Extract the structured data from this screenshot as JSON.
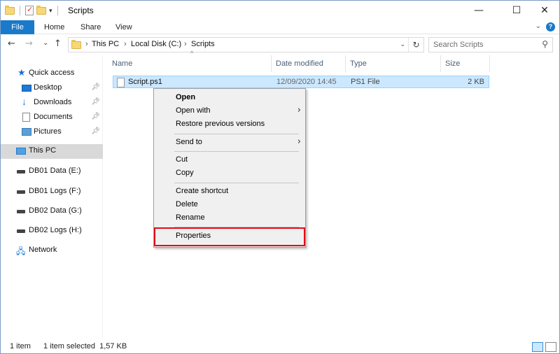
{
  "window": {
    "title": "Scripts",
    "minimize": "—",
    "maximize": "☐",
    "close": "✕"
  },
  "ribbon": {
    "tabs": [
      "File",
      "Home",
      "Share",
      "View"
    ],
    "help": "?"
  },
  "nav": {
    "back": "←",
    "forward": "→",
    "recent": "⌄",
    "up": "↑",
    "breadcrumb": [
      "This PC",
      "Local Disk (C:)",
      "Scripts"
    ],
    "refresh": "↻"
  },
  "search": {
    "placeholder": "Search Scripts"
  },
  "sidebar": {
    "quick_access": "Quick access",
    "items": [
      {
        "label": "Desktop",
        "pinned": true
      },
      {
        "label": "Downloads",
        "pinned": true
      },
      {
        "label": "Documents",
        "pinned": true
      },
      {
        "label": "Pictures",
        "pinned": true
      }
    ],
    "this_pc": "This PC",
    "drives": [
      "DB01 Data (E:)",
      "DB01 Logs (F:)",
      "DB02 Data (G:)",
      "DB02 Logs (H:)"
    ],
    "network": "Network"
  },
  "columns": {
    "name": "Name",
    "date_modified": "Date modified",
    "type": "Type",
    "size": "Size"
  },
  "files": [
    {
      "name": "Script.ps1",
      "date_modified": "12/09/2020 14:45",
      "type": "PS1 File",
      "size": "2 KB"
    }
  ],
  "context_menu": {
    "open": "Open",
    "open_with": "Open with",
    "restore": "Restore previous versions",
    "send_to": "Send to",
    "cut": "Cut",
    "copy": "Copy",
    "create_shortcut": "Create shortcut",
    "delete": "Delete",
    "rename": "Rename",
    "properties": "Properties",
    "highlight_color": "#e30b17"
  },
  "status": {
    "item_count": "1 item",
    "selection": "1 item selected  1,57 KB"
  },
  "colors": {
    "accent": "#1979ca",
    "selection_bg": "#cce8ff",
    "selection_border": "#99d1ff"
  }
}
